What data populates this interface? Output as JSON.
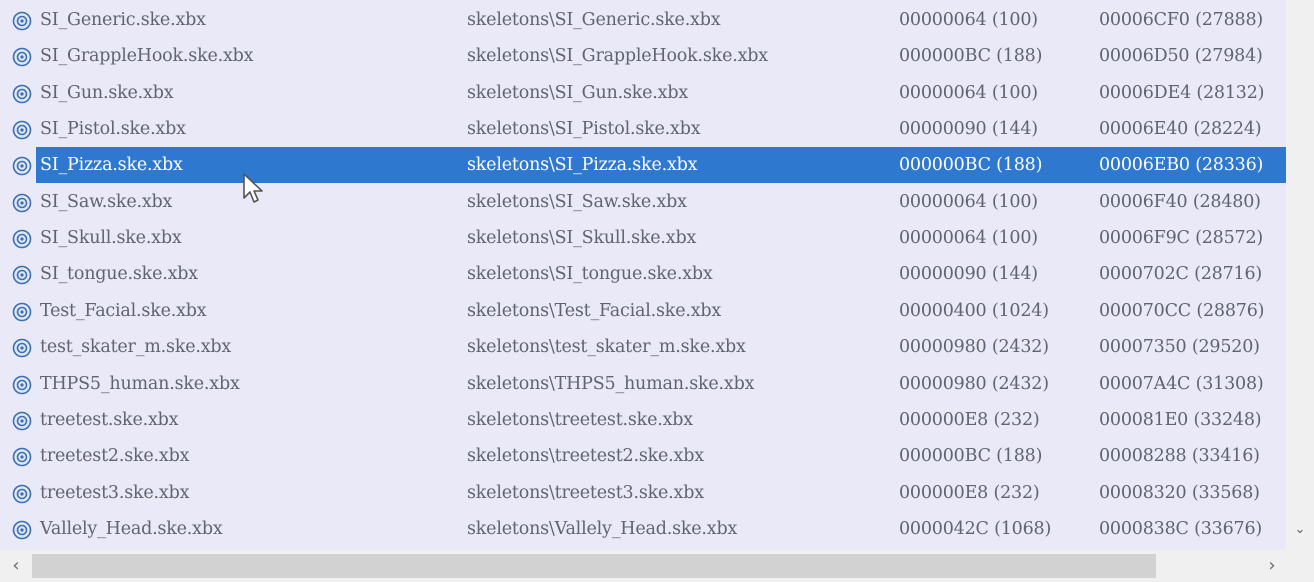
{
  "icon": "skeleton-file-icon",
  "colors": {
    "selection": "#2e78cf",
    "background": "#e9e9f8",
    "text": "#5f6470"
  },
  "rows": [
    {
      "name": "SI_Generic.ske.xbx",
      "path": "skeletons\\SI_Generic.ske.xbx",
      "size": "00000064 (100)",
      "offset": "00006CF0 (27888)"
    },
    {
      "name": "SI_GrappleHook.ske.xbx",
      "path": "skeletons\\SI_GrappleHook.ske.xbx",
      "size": "000000BC (188)",
      "offset": "00006D50 (27984)"
    },
    {
      "name": "SI_Gun.ske.xbx",
      "path": "skeletons\\SI_Gun.ske.xbx",
      "size": "00000064 (100)",
      "offset": "00006DE4 (28132)"
    },
    {
      "name": "SI_Pistol.ske.xbx",
      "path": "skeletons\\SI_Pistol.ske.xbx",
      "size": "00000090 (144)",
      "offset": "00006E40 (28224)"
    },
    {
      "name": "SI_Pizza.ske.xbx",
      "path": "skeletons\\SI_Pizza.ske.xbx",
      "size": "000000BC (188)",
      "offset": "00006EB0 (28336)",
      "selected": true
    },
    {
      "name": "SI_Saw.ske.xbx",
      "path": "skeletons\\SI_Saw.ske.xbx",
      "size": "00000064 (100)",
      "offset": "00006F40 (28480)"
    },
    {
      "name": "SI_Skull.ske.xbx",
      "path": "skeletons\\SI_Skull.ske.xbx",
      "size": "00000064 (100)",
      "offset": "00006F9C (28572)"
    },
    {
      "name": "SI_tongue.ske.xbx",
      "path": "skeletons\\SI_tongue.ske.xbx",
      "size": "00000090 (144)",
      "offset": "0000702C (28716)"
    },
    {
      "name": "Test_Facial.ske.xbx",
      "path": "skeletons\\Test_Facial.ske.xbx",
      "size": "00000400 (1024)",
      "offset": "000070CC (28876)"
    },
    {
      "name": "test_skater_m.ske.xbx",
      "path": "skeletons\\test_skater_m.ske.xbx",
      "size": "00000980 (2432)",
      "offset": "00007350 (29520)"
    },
    {
      "name": "THPS5_human.ske.xbx",
      "path": "skeletons\\THPS5_human.ske.xbx",
      "size": "00000980 (2432)",
      "offset": "00007A4C (31308)"
    },
    {
      "name": "treetest.ske.xbx",
      "path": "skeletons\\treetest.ske.xbx",
      "size": "000000E8 (232)",
      "offset": "000081E0 (33248)"
    },
    {
      "name": "treetest2.ske.xbx",
      "path": "skeletons\\treetest2.ske.xbx",
      "size": "000000BC (188)",
      "offset": "00008288 (33416)"
    },
    {
      "name": "treetest3.ske.xbx",
      "path": "skeletons\\treetest3.ske.xbx",
      "size": "000000E8 (232)",
      "offset": "00008320 (33568)"
    },
    {
      "name": "Vallely_Head.ske.xbx",
      "path": "skeletons\\Vallely_Head.ske.xbx",
      "size": "0000042C (1068)",
      "offset": "0000838C (33676)"
    }
  ],
  "scrollbar": {
    "up_icon": "chevron-down-icon",
    "left_icon": "chevron-left-icon",
    "right_icon": "chevron-right-icon"
  }
}
